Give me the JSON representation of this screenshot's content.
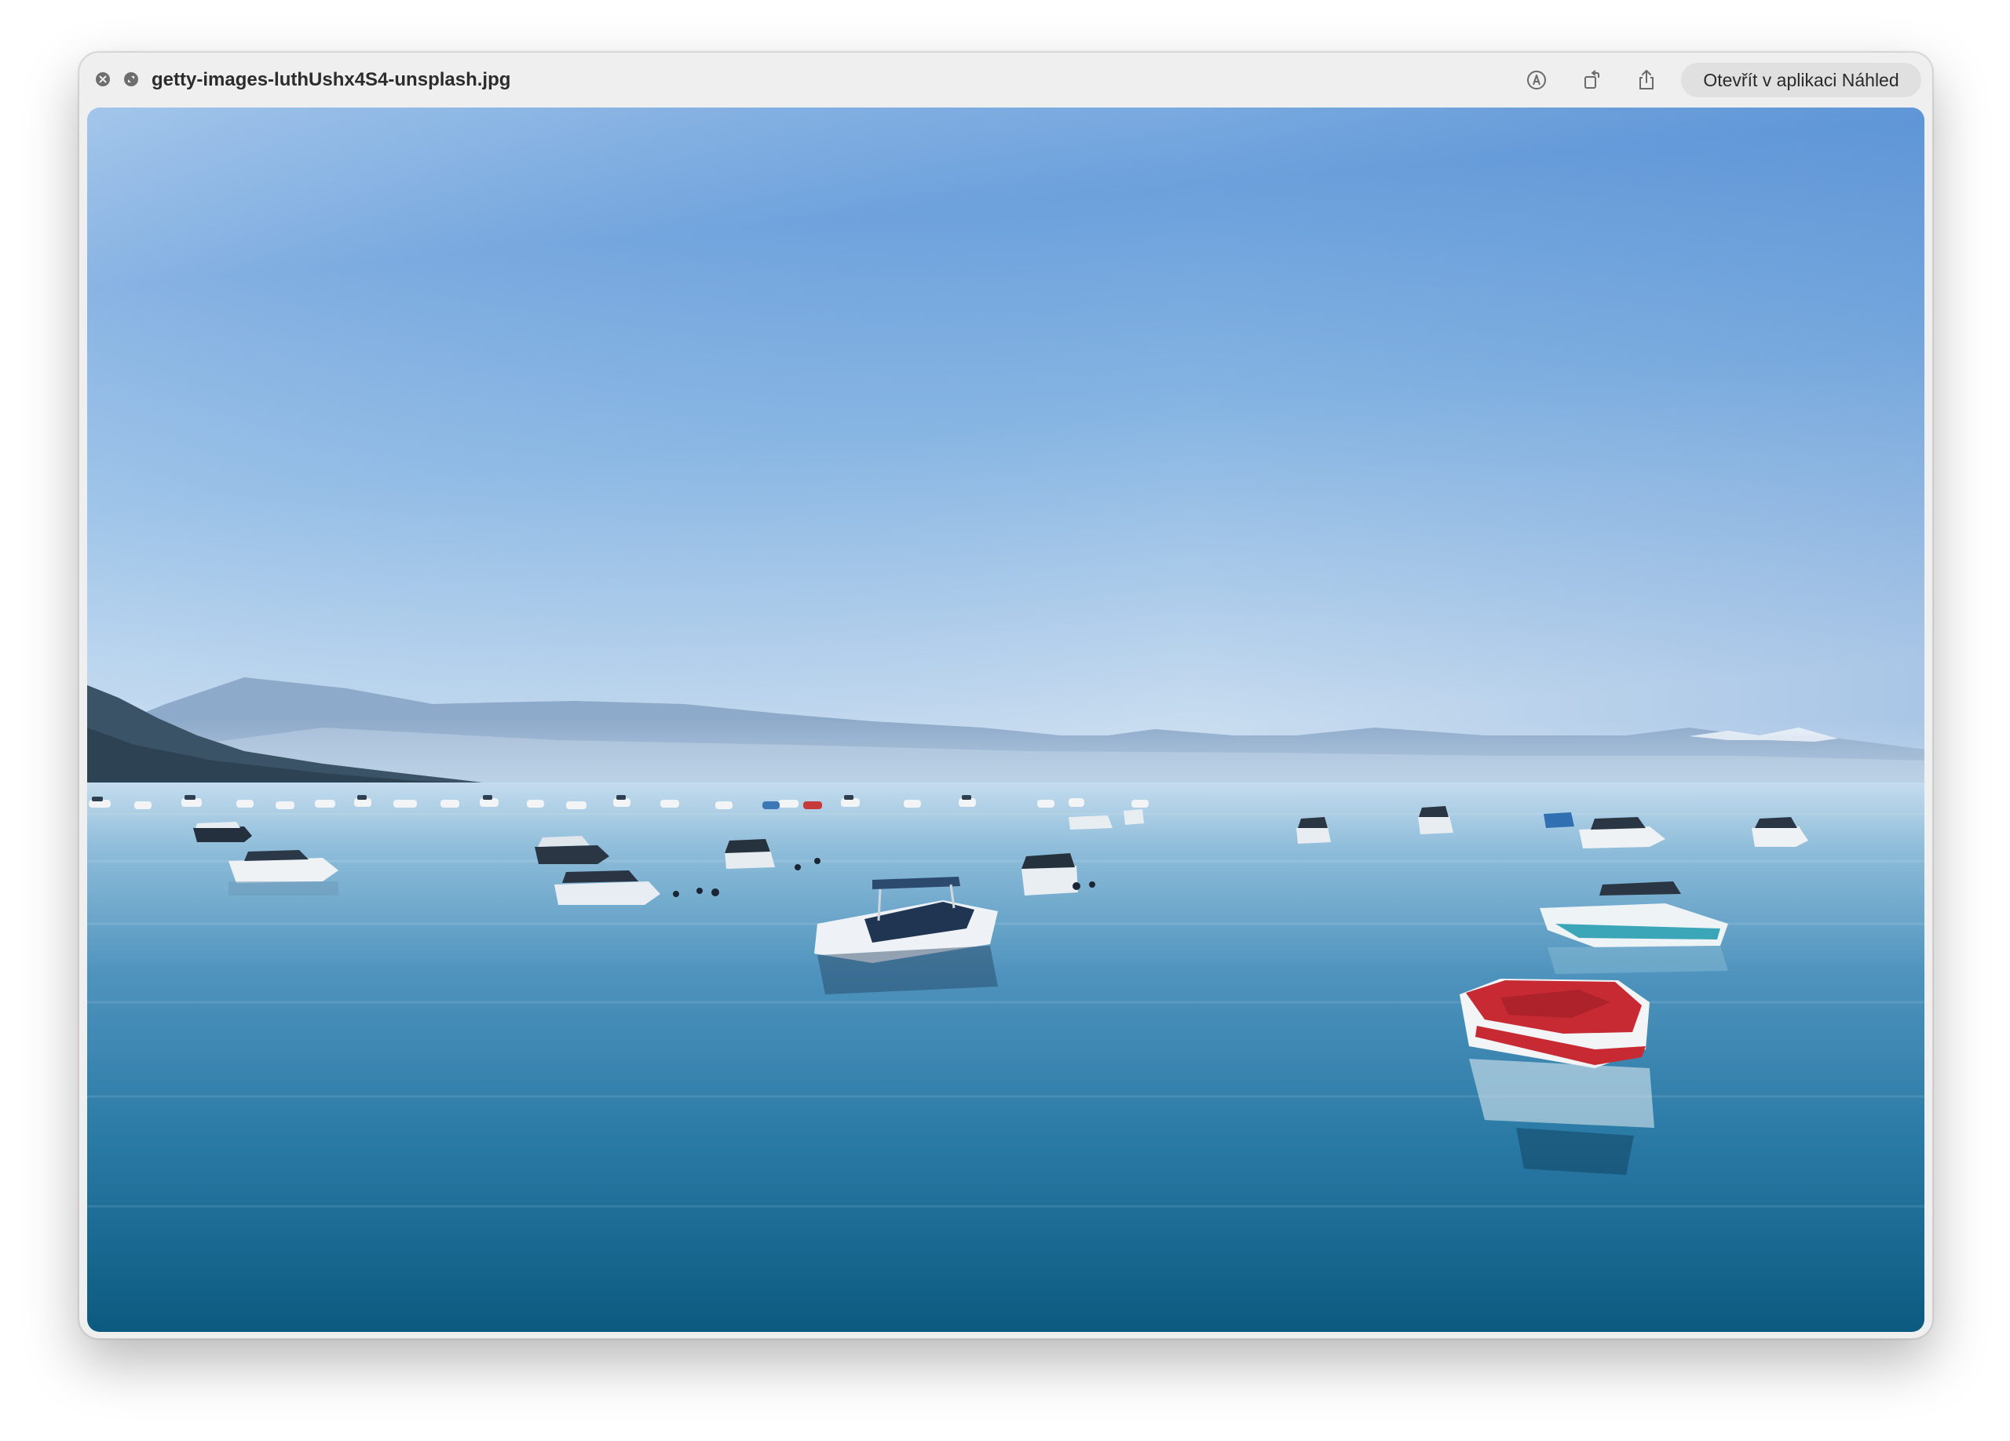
{
  "window": {
    "title": "getty-images-luthUshx4S4-unsplash.jpg",
    "open_button_label": "Otevřít v aplikaci Náhled"
  },
  "icons": {
    "close": "close-icon",
    "fullscreen": "fullscreen-icon",
    "markup": "markup-icon",
    "rotate": "rotate-icon",
    "share": "share-icon"
  },
  "photo": {
    "subject": "boats-on-lake",
    "colors": {
      "sky_top": "#4a8fd9",
      "sky_horizon": "#cfe0f1",
      "water_top": "#b9d6ea",
      "water_bottom": "#0e5f85",
      "mountains": "#7f9fbf",
      "forest": "#3e5668",
      "accent_boat": "#c82a33"
    }
  }
}
